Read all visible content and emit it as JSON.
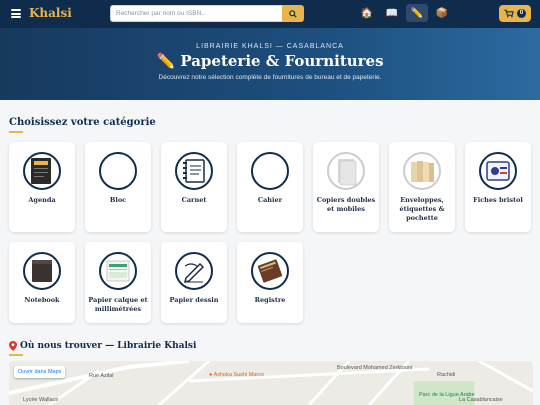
{
  "header": {
    "brand": "Khalsi",
    "search_placeholder": "Rechercher par nom ou ISBN...",
    "nav": [
      {
        "icon": "home-icon",
        "glyph": "🏠"
      },
      {
        "icon": "book-icon",
        "glyph": "📖"
      },
      {
        "icon": "pencil-icon",
        "glyph": "✏️"
      },
      {
        "icon": "package-icon",
        "glyph": "📦"
      }
    ],
    "cart_count": "0"
  },
  "hero": {
    "kicker": "LIBRAIRIE KHALSI — CASABLANCA",
    "title": "✏️ Papeterie & Fournitures",
    "subtitle": "Découvrez notre sélection complète de fournitures de bureau et de papeterie."
  },
  "categories_section": {
    "title": "Choisissez votre catégorie",
    "items": [
      {
        "label": "Agenda",
        "icon": "agenda-icon"
      },
      {
        "label": "Bloc",
        "icon": "bloc-icon"
      },
      {
        "label": "Carnet",
        "icon": "carnet-icon"
      },
      {
        "label": "Cahier",
        "icon": "cahier-icon"
      },
      {
        "label": "Copiers doubles et mobiles",
        "icon": "copier-icon"
      },
      {
        "label": "Enveloppes, étiquettes & pochette",
        "icon": "envelope-icon"
      },
      {
        "label": "Fiches bristol",
        "icon": "bristol-icon"
      },
      {
        "label": "Notebook",
        "icon": "notebook-icon"
      },
      {
        "label": "Papier calque et millimétrées",
        "icon": "tracing-paper-icon"
      },
      {
        "label": "Papier dessin",
        "icon": "drawing-paper-icon"
      },
      {
        "label": "Registre",
        "icon": "registre-icon"
      }
    ]
  },
  "location": {
    "title": "Où nous trouver — Librairie Khalsi",
    "open_maps": "Ouvrir dans Maps",
    "map_labels": [
      "Rue Azilal",
      "Ashoka Sushi Marco",
      "Boulevard Mohamed Zerktouni",
      "Rachidi",
      "Parc de la Ligue Arabe",
      "La Casablancaise",
      "Lycée Wallace"
    ]
  },
  "colors": {
    "navy": "#0f2c4c",
    "gold": "#e9b44c",
    "hero_gradient_end": "#2c6aa0"
  }
}
